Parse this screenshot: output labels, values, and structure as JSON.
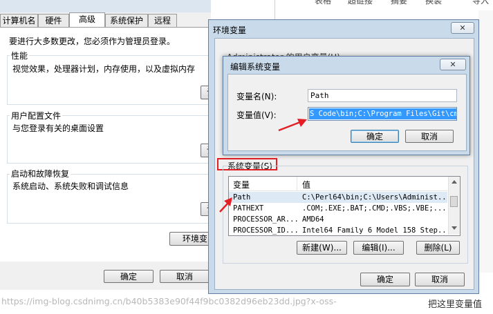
{
  "top_strip": [
    "表格",
    "超链接",
    "摘要",
    "换装",
    "导入"
  ],
  "sys_props": {
    "tabs": [
      "计算机名",
      "硬件",
      "高级",
      "系统保护",
      "远程"
    ],
    "active_tab": "高级",
    "admin_note": "要进行大多数更改，您必须作为管理员登录。",
    "performance": {
      "title": "性能",
      "desc": "视觉效果，处理器计划，内存使用，以及虚拟内存",
      "button": "设"
    },
    "user_profile": {
      "title": "用户配置文件",
      "desc": "与您登录有关的桌面设置",
      "button": "设"
    },
    "startup": {
      "title": "启动和故障恢复",
      "desc": "系统启动、系统失败和调试信息",
      "button": "设"
    },
    "env_button": "环境变",
    "ok": "确定",
    "cancel": "取消"
  },
  "env_vars": {
    "title": "环境变量",
    "close": "✕",
    "user_section_partial": "Administrator 的用户变量(U)",
    "system_section": "系统变量(S)",
    "columns": [
      "变量",
      "值"
    ],
    "rows": [
      {
        "name": "Path",
        "value": "C:\\Perl64\\bin;C:\\Users\\Administ..."
      },
      {
        "name": "PATHEXT",
        "value": ".COM;.EXE;.BAT;.CMD;.VBS;.VBE;...."
      },
      {
        "name": "PROCESSOR_AR...",
        "value": "AMD64"
      },
      {
        "name": "PROCESSOR_ID...",
        "value": "Intel64 Family 6 Model 158 Step..."
      }
    ],
    "new": "新建(W)...",
    "edit": "编辑(I)...",
    "delete": "删除(L)",
    "ok": "确定",
    "cancel": "取消"
  },
  "edit_var": {
    "title": "编辑系统变量",
    "close": "✕",
    "name_label": "变量名(N):",
    "name_value": "Path",
    "value_label": "变量值(V):",
    "value_value": "S Code\\bin;C:\\Program Files\\Git\\cmd",
    "ok": "确定",
    "cancel": "取消"
  },
  "watermark": "https://img-blog.csdnimg.cn/b40b5383e90f44f9bc0382d96eb23dd.jpg?x-oss-",
  "bottom_right_text": "把这里变量值",
  "colors": {
    "annotation_red": "#e31e24",
    "selection": "#3399ff",
    "title_bar": "#c9daea"
  }
}
